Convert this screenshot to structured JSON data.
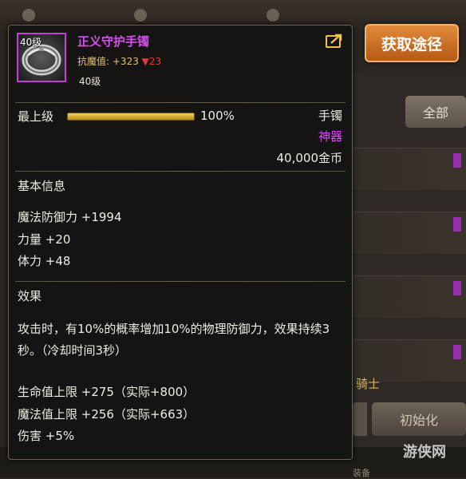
{
  "background": {
    "obtain_button": "获取途径",
    "all_button": "全部",
    "init_button": "初始化",
    "knight_text": "骑士",
    "equip_text": "装备",
    "watermark": "游侠网"
  },
  "tooltip": {
    "level_badge": "40级",
    "item_name": "正义守护手镯",
    "resist_label": "抗魔值:",
    "resist_value": "+323",
    "resist_change": "▼23",
    "level_text": "40级",
    "enhance_label": "最上级",
    "enhance_percent": "100%",
    "enhance_progress": 1.0,
    "item_type": "手镯",
    "item_grade": "神器",
    "price": "40,000金币",
    "basic_title": "基本信息",
    "basic_stats": [
      "魔法防御力 +1994",
      "力量 +20",
      "体力 +48"
    ],
    "effect_title": "效果",
    "effect_desc": "攻击时，有10%的概率增加10%的物理防御力，效果持续3秒。（冷却时间3秒）",
    "effect_stats": [
      "生命值上限 +275（实际+800）",
      "魔法值上限 +256（实际+663）",
      "伤害 +5%"
    ]
  },
  "colors": {
    "epic": "#d54ff0",
    "gold": "#e3c46a",
    "down": "#e03a3a",
    "obtain_button": "#d07528"
  },
  "icons": [
    "bracelet-icon",
    "share-icon"
  ]
}
